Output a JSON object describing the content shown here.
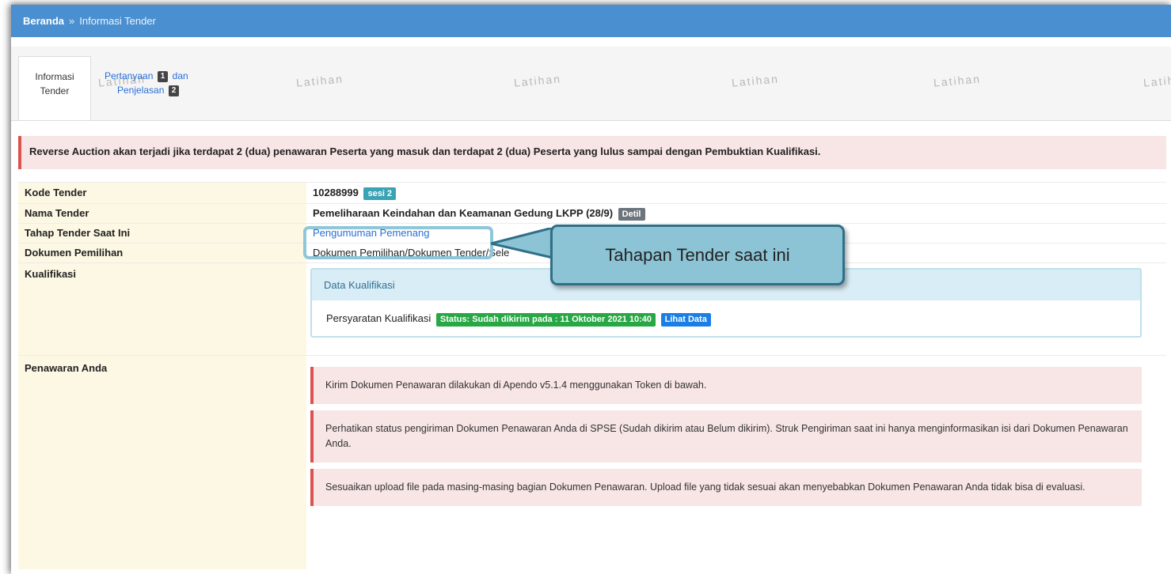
{
  "breadcrumb": {
    "home": "Beranda",
    "separator": "»",
    "current": "Informasi Tender"
  },
  "tabs": {
    "info_line1": "Informasi",
    "info_line2": "Tender",
    "qa_line1": "Pertanyaan",
    "qa_count": "1",
    "qa_and": "dan",
    "qa_line2": "Penjelasan",
    "qa_count2": "2"
  },
  "watermark": "Latihan",
  "alert_top": "Reverse Auction akan terjadi jika terdapat 2 (dua) penawaran Peserta yang masuk dan terdapat 2 (dua) Peserta yang lulus sampai dengan Pembuktian Kualifikasi.",
  "rows": {
    "kode_label": "Kode Tender",
    "kode_value": "10288999",
    "kode_badge": "sesi 2",
    "nama_label": "Nama Tender",
    "nama_value": "Pemeliharaan Keindahan dan Keamanan Gedung LKPP (28/9)",
    "nama_badge": "Detil",
    "tahap_label": "Tahap Tender Saat Ini",
    "tahap_value": "Pengumuman Pemenang",
    "dokumen_label": "Dokumen Pemilihan",
    "dokumen_value": "Dokumen Pemilihan/Dokumen Tender/Sele",
    "kualifikasi_label": "Kualifikasi",
    "penawaran_label": "Penawaran Anda"
  },
  "kualifikasi_panel": {
    "title": "Data Kualifikasi",
    "item_label": "Persyaratan Kualifikasi",
    "status": "Status: Sudah dikirim pada : 11 Oktober 2021 10:40",
    "action": "Lihat Data"
  },
  "notes": [
    "Kirim Dokumen Penawaran dilakukan di Apendo v5.1.4 menggunakan Token di bawah.",
    "Perhatikan status pengiriman Dokumen Penawaran Anda di SPSE (Sudah dikirim atau Belum dikirim). Struk Pengiriman saat ini hanya menginformasikan isi dari Dokumen Penawaran Anda.",
    "Sesuaikan upload file pada masing-masing bagian Dokumen Penawaran. Upload file yang tidak sesuai akan menyebabkan Dokumen Penawaran Anda tidak bisa di evaluasi."
  ],
  "callout": "Tahapan Tender saat ini",
  "colors": {
    "header": "#4a8fd0",
    "label_bg": "#fcf8e3",
    "alert_border": "#d9534f",
    "callout_fill": "#8cc3d5"
  }
}
